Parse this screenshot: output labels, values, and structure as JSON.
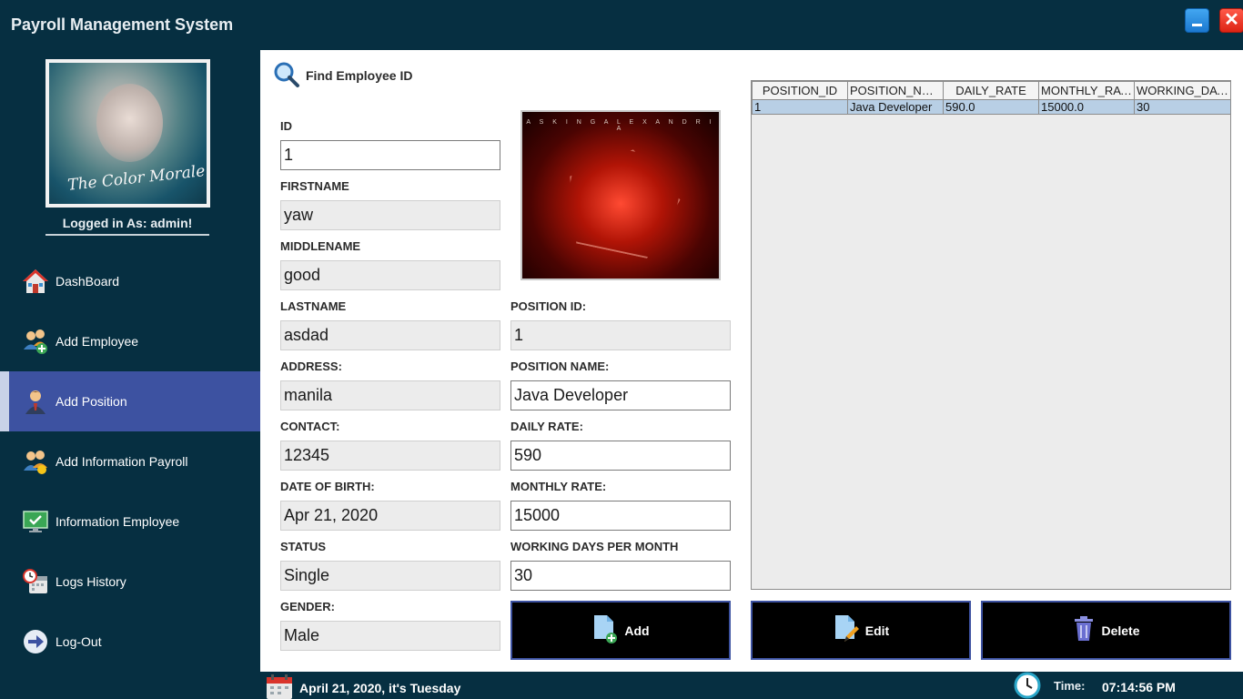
{
  "window": {
    "title": "Payroll Management System",
    "close_glyph": "✕"
  },
  "sidebar": {
    "logged_in": "Logged in As: admin!",
    "items": [
      {
        "label": "DashBoard",
        "icon": "home-icon"
      },
      {
        "label": "Add Employee",
        "icon": "add-user-icon"
      },
      {
        "label": "Add Position",
        "icon": "manager-icon",
        "active": true
      },
      {
        "label": "Add Information Payroll",
        "icon": "payroll-users-icon"
      },
      {
        "label": "Information Employee",
        "icon": "monitor-check-icon"
      },
      {
        "label": "Logs History",
        "icon": "calendar-clock-icon"
      },
      {
        "label": "Log-Out",
        "icon": "arrow-right-icon"
      }
    ]
  },
  "search": {
    "label": "Find Employee ID"
  },
  "album": {
    "text": "A S K I N G   A L E X A N D R I A"
  },
  "employee": {
    "id_label": "ID",
    "id_value": "1",
    "firstname_label": "FIRSTNAME",
    "firstname_value": "yaw",
    "middlename_label": "MIDDLENAME",
    "middlename_value": "good",
    "lastname_label": "LASTNAME",
    "lastname_value": "asdad",
    "address_label": "ADDRESS:",
    "address_value": "manila",
    "contact_label": "CONTACT:",
    "contact_value": "12345",
    "dob_label": "DATE OF BIRTH:",
    "dob_value": "Apr 21, 2020",
    "status_label": "STATUS",
    "status_value": "Single",
    "gender_label": "GENDER:",
    "gender_value": "Male"
  },
  "position": {
    "id_label": "POSITION ID:",
    "id_value": "1",
    "name_label": "POSITION NAME:",
    "name_value": "Java Developer",
    "daily_label": "DAILY RATE:",
    "daily_value": "590",
    "monthly_label": "MONTHLY RATE:",
    "monthly_value": "15000",
    "days_label": "WORKING DAYS PER MONTH",
    "days_value": "30"
  },
  "table": {
    "headers": [
      "POSITION_ID",
      "POSITION_NAME",
      "DAILY_RATE",
      "MONTHLY_RATE",
      "WORKING_DAY..."
    ],
    "rows": [
      [
        "1",
        "Java Developer",
        "590.0",
        "15000.0",
        "30"
      ]
    ]
  },
  "buttons": {
    "add": "Add",
    "edit": "Edit",
    "delete": "Delete"
  },
  "footer": {
    "date": "April 21, 2020, it's Tuesday",
    "time_label": "Time:",
    "time_value": "07:14:56 PM"
  },
  "colors": {
    "background": "#062f41",
    "active_nav": "#3d52a1",
    "selected_row": "#b8cfe5"
  }
}
